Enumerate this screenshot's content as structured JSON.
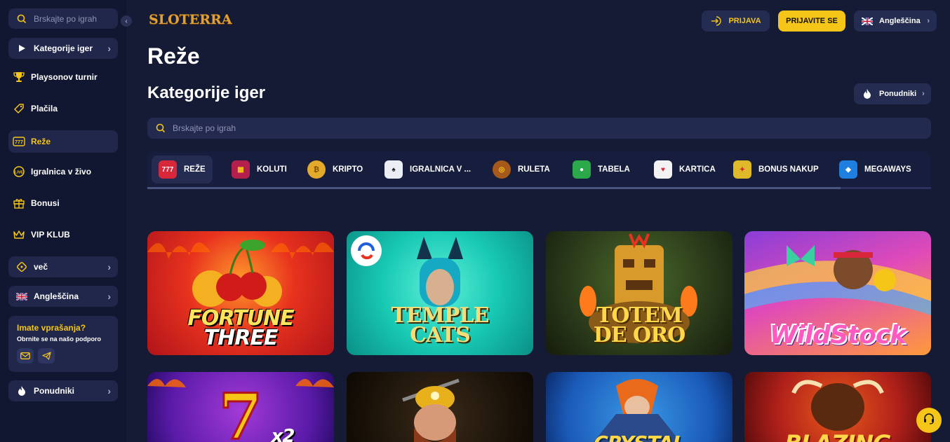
{
  "sidebar": {
    "search_placeholder": "Brskajte po igrah",
    "categories_button": "Kategorije iger",
    "items": [
      {
        "label": "Playsonov turnir",
        "icon": "trophy-icon"
      },
      {
        "label": "Plačila",
        "icon": "tag-icon"
      },
      {
        "label": "Reže",
        "icon": "slot-777-icon"
      },
      {
        "label": "Igralnica v živo",
        "icon": "live-casino-icon"
      },
      {
        "label": "Bonusi",
        "icon": "gift-icon"
      },
      {
        "label": "VIP KLUB",
        "icon": "crown-icon"
      }
    ],
    "more_button": "več",
    "language_button": "Angleščina",
    "help": {
      "title": "Imate vprašanja?",
      "subtitle": "Obrnite se na našo podporo"
    },
    "providers_button": "Ponudniki"
  },
  "header": {
    "logo": "SLOTERRA",
    "login": "PRIJAVA",
    "register": "PRIJAVITE SE",
    "language": "Angleščina"
  },
  "page": {
    "title": "Reže",
    "section_title": "Kategorije iger",
    "providers_button": "Ponudniki",
    "search_placeholder": "Brskajte po igrah"
  },
  "categories": [
    {
      "label": "REŽE",
      "icon": "slot-machine-icon",
      "active": true
    },
    {
      "label": "KOLUTI",
      "icon": "reels-icon",
      "active": false
    },
    {
      "label": "KRIPTO",
      "icon": "crypto-coin-icon",
      "active": false
    },
    {
      "label": "IGRALNICA V ...",
      "icon": "live-dealer-icon",
      "active": false
    },
    {
      "label": "RULETA",
      "icon": "roulette-icon",
      "active": false
    },
    {
      "label": "TABELA",
      "icon": "chips-icon",
      "active": false
    },
    {
      "label": "KARTICA",
      "icon": "playing-card-icon",
      "active": false
    },
    {
      "label": "BONUS NAKUP",
      "icon": "bonus-buy-icon",
      "active": false
    },
    {
      "label": "MEGAWAYS",
      "icon": "megaways-icon",
      "active": false
    }
  ],
  "games_row1": [
    {
      "title_line1": "FORTUNE",
      "title_line2": "THREE"
    },
    {
      "title_line1": "TEMPLE",
      "title_line2": "CATS"
    },
    {
      "title_line1": "TOTEM",
      "title_line2": "DE ORO"
    },
    {
      "title_line1": "WildStock",
      "title_line2": ""
    }
  ],
  "games_row2": [
    {
      "title_line1": "x2",
      "title_line2": ""
    },
    {
      "title_line1": "",
      "title_line2": ""
    },
    {
      "title_line1": "CRYSTAL",
      "title_line2": ""
    },
    {
      "title_line1": "BLAZING",
      "title_line2": ""
    }
  ],
  "colors": {
    "accent": "#f5c518",
    "background": "#151a35",
    "sidebar": "#121731",
    "panel": "#20274a"
  }
}
